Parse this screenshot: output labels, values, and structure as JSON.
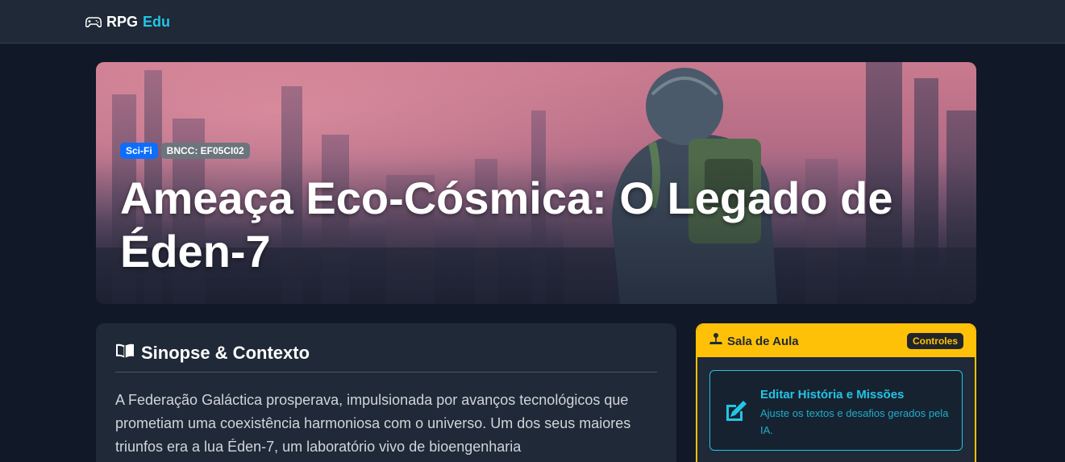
{
  "navbar": {
    "brand_main": "RPG",
    "brand_accent": "Edu",
    "brand_icon": "gamepad-icon"
  },
  "hero": {
    "badges": [
      "Sci-Fi",
      "BNCC: EF05CI02"
    ],
    "title": "Ameaça Eco-Cósmica: O Legado de Éden-7",
    "badge_colors": {
      "genre": "#0d6efd",
      "bncc": "#6c757d"
    }
  },
  "synopsis": {
    "icon": "book-open-icon",
    "heading": "Sinopse & Contexto",
    "text": "A Federação Galáctica prosperava, impulsionada por avanços tecnológicos que prometiam uma coexistência harmoniosa com o universo. Um dos seus maiores triunfos era a lua Éden-7, um laboratório vivo de bioengenharia"
  },
  "classroom": {
    "icon": "joystick-icon",
    "title": "Sala de Aula",
    "badge": "Controles",
    "edit": {
      "icon": "pencil-square-icon",
      "title": "Editar História e Missões",
      "description": "Ajuste os textos e desafios gerados pela IA."
    },
    "accent": "#ffc107",
    "link_color": "#22c5e6"
  }
}
